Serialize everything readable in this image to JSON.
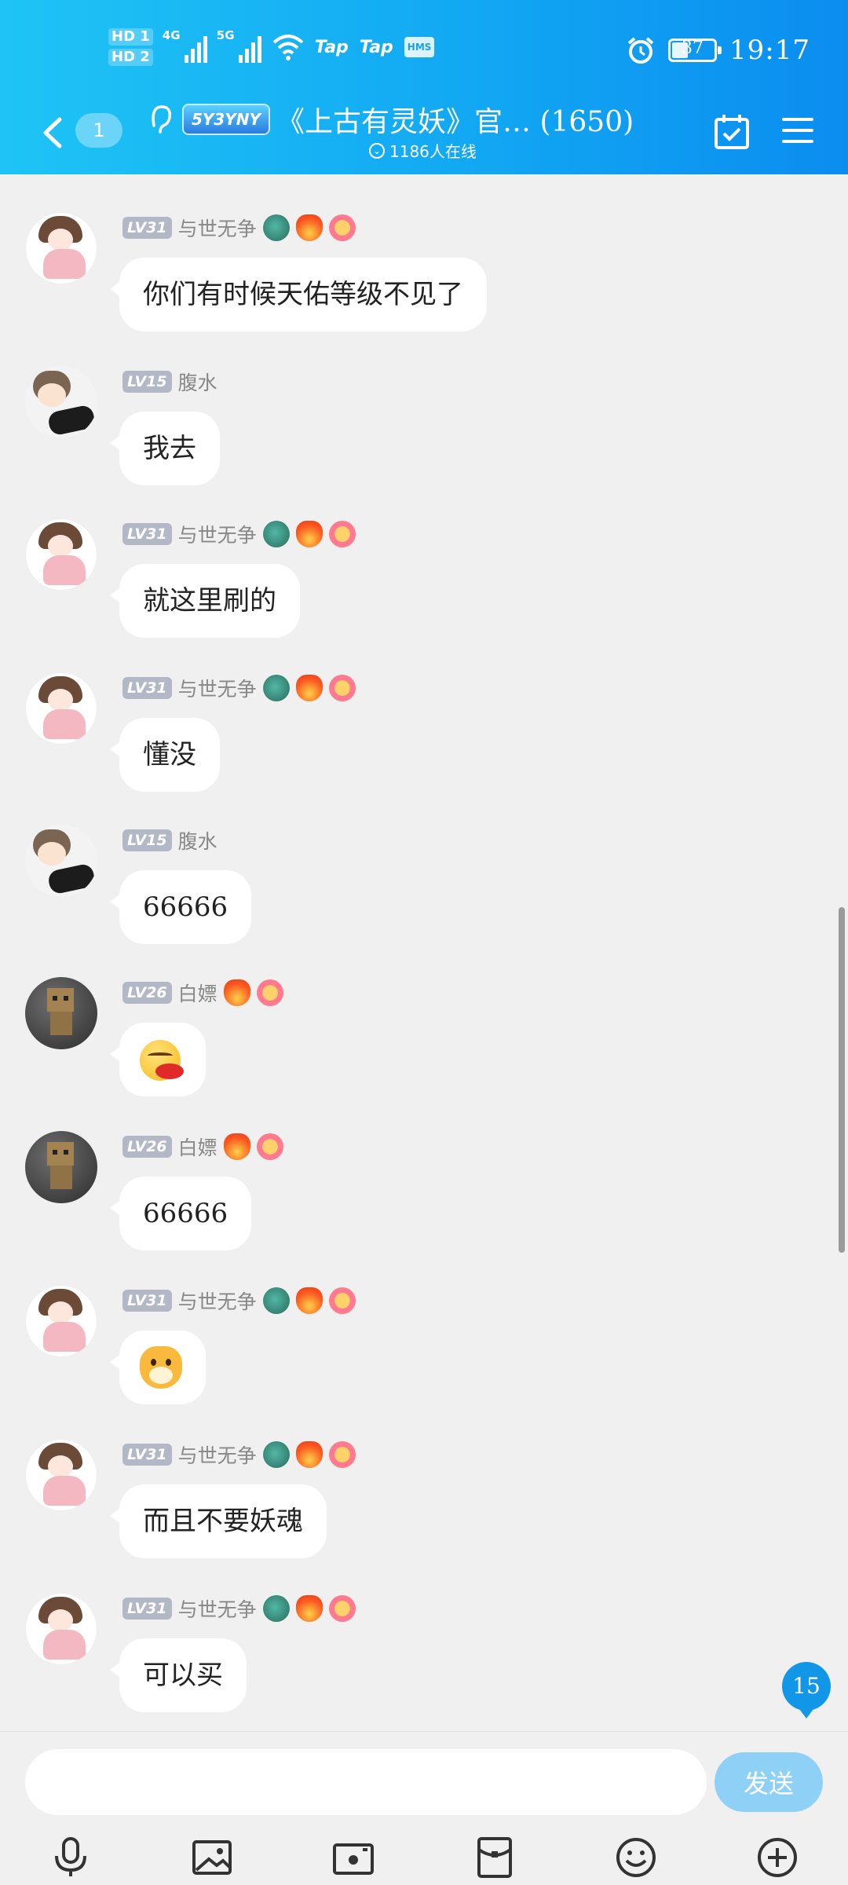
{
  "status_bar": {
    "hd1": "HD 1",
    "hd2": "HD 2",
    "net1": "4G",
    "net2": "5G",
    "app_badge1": "Tap",
    "app_badge2": "Tap",
    "hms": "HMS",
    "battery": "37",
    "time": "19:17"
  },
  "header": {
    "unread_count": "1",
    "game_logo_text": "5Y3YNY",
    "title": "《上古有灵妖》官… (1650)",
    "online": "1186人在线",
    "accent_color": "#12a8f3"
  },
  "messages": [
    {
      "level": "LV31",
      "name": "与世无争",
      "text": "你们有时候天佑等级不见了",
      "badges": [
        "dragon-icon",
        "fire-icon",
        "flower-icon"
      ]
    },
    {
      "level": "LV15",
      "name": "腹水",
      "text": "我去",
      "badges": []
    },
    {
      "level": "LV31",
      "name": "与世无争",
      "text": "就这里刷的",
      "badges": [
        "dragon-icon",
        "fire-icon",
        "flower-icon"
      ]
    },
    {
      "level": "LV31",
      "name": "与世无争",
      "text": "懂没",
      "badges": [
        "dragon-icon",
        "fire-icon",
        "flower-icon"
      ]
    },
    {
      "level": "LV15",
      "name": "腹水",
      "text": "66666",
      "badges": []
    },
    {
      "level": "LV26",
      "name": "白嫖",
      "text": "",
      "emoji": "bleeding-face-emoji",
      "badges": [
        "fire-icon",
        "flower-icon"
      ]
    },
    {
      "level": "LV26",
      "name": "白嫖",
      "text": "66666",
      "badges": [
        "fire-icon",
        "flower-icon"
      ]
    },
    {
      "level": "LV31",
      "name": "与世无争",
      "text": "",
      "emoji": "dog-face-emoji",
      "badges": [
        "dragon-icon",
        "fire-icon",
        "flower-icon"
      ]
    },
    {
      "level": "LV31",
      "name": "与世无争",
      "text": "而且不要妖魂",
      "badges": [
        "dragon-icon",
        "fire-icon",
        "flower-icon"
      ]
    },
    {
      "level": "LV31",
      "name": "与世无争",
      "text": "可以买",
      "badges": [
        "dragon-icon",
        "fire-icon",
        "flower-icon"
      ]
    }
  ],
  "new_message_count": "15",
  "input": {
    "value": "",
    "send_label": "发送"
  },
  "toolbar": [
    "microphone-icon",
    "picture-icon",
    "camera-icon",
    "red-packet-icon",
    "emoji-icon",
    "plus-icon"
  ]
}
